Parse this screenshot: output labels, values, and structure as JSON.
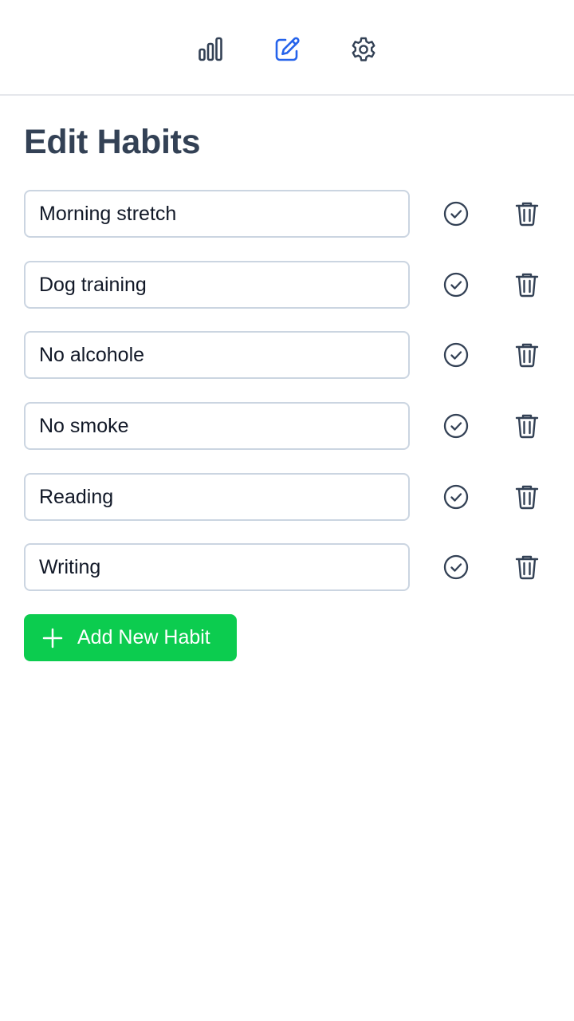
{
  "nav": {
    "items": [
      {
        "name": "stats",
        "icon": "bar-chart-icon",
        "active": false
      },
      {
        "name": "edit",
        "icon": "edit-icon",
        "active": true
      },
      {
        "name": "settings",
        "icon": "gear-icon",
        "active": false
      }
    ]
  },
  "page": {
    "title": "Edit Habits"
  },
  "habits": [
    {
      "value": "Morning stretch"
    },
    {
      "value": "Dog training"
    },
    {
      "value": "No alcohole"
    },
    {
      "value": "No smoke"
    },
    {
      "value": "Reading"
    },
    {
      "value": "Writing"
    }
  ],
  "actions": {
    "add_label": "Add New Habit"
  },
  "colors": {
    "accent": "#2563eb",
    "icon": "#334155",
    "add_button": "#0ccc4f",
    "title": "#334155"
  }
}
